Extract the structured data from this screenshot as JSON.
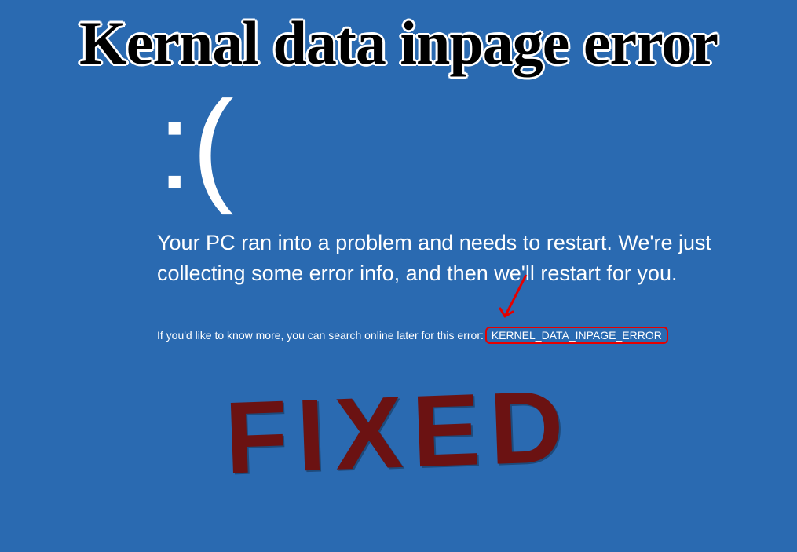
{
  "title": "Kernal data inpage error",
  "frowny": ":(",
  "mainMessage": "Your PC ran into a problem and needs to restart. We're just collecting some error info, and then we'll restart for you.",
  "subMessagePrefix": "If you'd like to know more, you can search online later for this error: ",
  "errorCode": "KERNEL_DATA_INPAGE_ERROR",
  "stamp": "FIXED",
  "colors": {
    "background": "#2a6ab1",
    "text": "#ffffff",
    "highlight": "#e50000",
    "stamp": "#6b1212"
  }
}
